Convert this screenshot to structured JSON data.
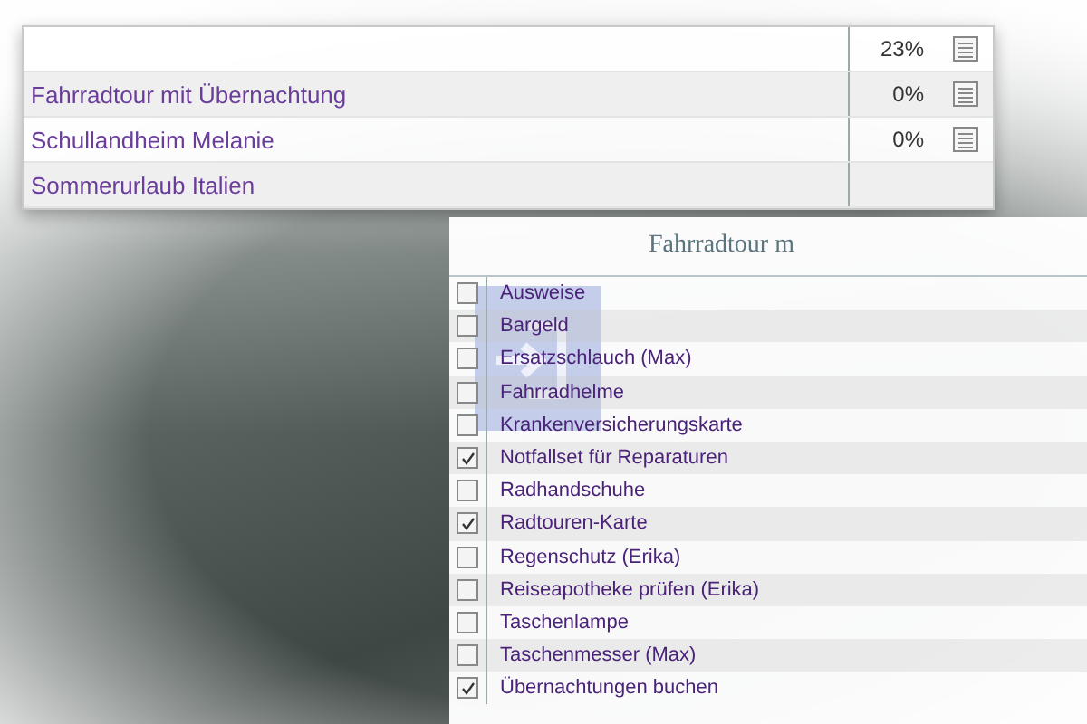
{
  "trips": [
    {
      "progress": "23%"
    },
    {
      "name": "Fahrradtour mit Übernachtung",
      "progress": "0%"
    },
    {
      "name": "Schullandheim Melanie",
      "progress": "0%"
    },
    {
      "name": "Sommerurlaub Italien"
    }
  ],
  "checklist": {
    "title": "Fahrradtour m",
    "items": [
      {
        "label": "Ausweise",
        "checked": false
      },
      {
        "label": "Bargeld",
        "checked": false
      },
      {
        "label": "Ersatzschlauch (Max)",
        "checked": false
      },
      {
        "label": "Fahrradhelme",
        "checked": false
      },
      {
        "label": "Krankenversicherungskarte",
        "checked": false
      },
      {
        "label": "Notfallset für Reparaturen",
        "checked": true
      },
      {
        "label": "Radhandschuhe",
        "checked": false
      },
      {
        "label": "Radtouren-Karte",
        "checked": true
      },
      {
        "label": "Regenschutz (Erika)",
        "checked": false
      },
      {
        "label": "Reiseapotheke prüfen (Erika)",
        "checked": false
      },
      {
        "label": "Taschenlampe",
        "checked": false
      },
      {
        "label": "Taschenmesser (Max)",
        "checked": false
      },
      {
        "label": "Übernachtungen buchen",
        "checked": true
      }
    ]
  }
}
